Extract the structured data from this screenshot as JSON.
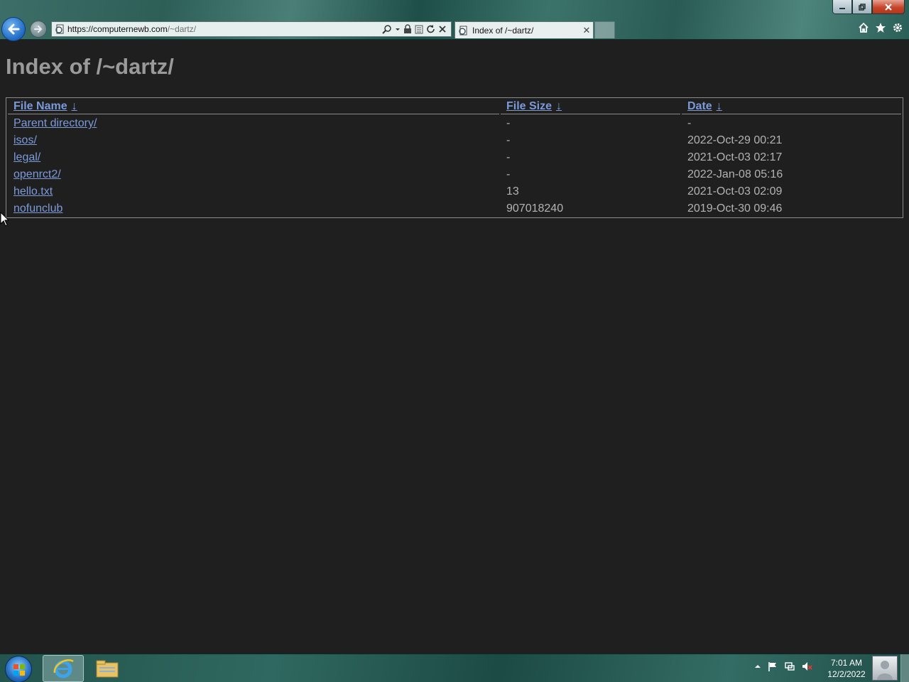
{
  "browser": {
    "address": {
      "host": "https://computernewb.com",
      "path": "/~dartz/"
    },
    "tab": {
      "label": "Index of /~dartz/"
    }
  },
  "icons": {
    "back": "back-arrow-icon",
    "forward": "forward-arrow-icon",
    "site": "page-icon",
    "search": "search-icon",
    "lock": "lock-icon",
    "compat": "compatibility-icon",
    "refresh": "refresh-icon",
    "stop": "stop-icon",
    "home": "home-icon",
    "favorites": "star-icon",
    "tools": "gear-icon"
  },
  "page": {
    "title": "Index of /~dartz/",
    "columns": [
      {
        "label": "File Name",
        "sort": "↓"
      },
      {
        "label": "File Size",
        "sort": "↓"
      },
      {
        "label": "Date",
        "sort": "↓"
      }
    ],
    "rows": [
      {
        "name": "Parent directory/",
        "size": "-",
        "date": "-"
      },
      {
        "name": "isos/",
        "size": "-",
        "date": "2022-Oct-29 00:21"
      },
      {
        "name": "legal/",
        "size": "-",
        "date": "2021-Oct-03 02:17"
      },
      {
        "name": "openrct2/",
        "size": "-",
        "date": "2022-Jan-08 05:16"
      },
      {
        "name": "hello.txt",
        "size": "13",
        "date": "2021-Oct-03 02:09"
      },
      {
        "name": "nofunclub",
        "size": "907018240",
        "date": "2019-Oct-30 09:46"
      }
    ]
  },
  "taskbar": {
    "time": "7:01 AM",
    "date": "12/2/2022"
  },
  "colors": {
    "link": "#7d9ad8",
    "page_bg": "#1f1f1f",
    "text": "#b3b3b3",
    "title": "#9a9a9a"
  }
}
